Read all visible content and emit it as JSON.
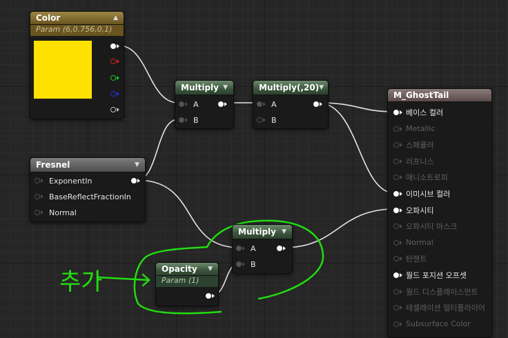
{
  "nodes": {
    "color": {
      "title": "Color",
      "subtitle": "Param (6,0.756,0,1)",
      "swatch": "#ffe100"
    },
    "multiply1": {
      "title": "Multiply",
      "a": "A",
      "b": "B"
    },
    "multiply2": {
      "title": "Multiply(,20)",
      "a": "A",
      "b": "B"
    },
    "fresnel": {
      "title": "Fresnel",
      "inputs": [
        "ExponentIn",
        "BaseReflectFractionIn",
        "Normal"
      ]
    },
    "multiply3": {
      "title": "Multiply",
      "a": "A",
      "b": "B"
    },
    "opacity": {
      "title": "Opacity",
      "subtitle": "Param (1)"
    },
    "material": {
      "title": "M_GhostTail",
      "pins": [
        {
          "label": "베이스 컬러",
          "active": true
        },
        {
          "label": "Metallic",
          "active": false
        },
        {
          "label": "스페큘러",
          "active": false
        },
        {
          "label": "러프니스",
          "active": false
        },
        {
          "label": "애니소트로피",
          "active": false
        },
        {
          "label": "이미시브 컬러",
          "active": true
        },
        {
          "label": "오파시티",
          "active": true
        },
        {
          "label": "오파시티 마스크",
          "active": false
        },
        {
          "label": "Normal",
          "active": false
        },
        {
          "label": "탄젠트",
          "active": false
        },
        {
          "label": "월드 포지션 오프셋",
          "active": true
        },
        {
          "label": "월드 디스플레이스먼트",
          "active": false
        },
        {
          "label": "테셀레이션 멀티플라이어",
          "active": false
        },
        {
          "label": "Subsurface Color",
          "active": false
        }
      ]
    }
  },
  "annotation": {
    "text": "추가",
    "color": "#22dd11"
  },
  "colors": {
    "wire": "#e8e8e8",
    "annotation": "#22dd11",
    "header_gold": "#8a7430",
    "header_green": "#4b6a4d"
  }
}
